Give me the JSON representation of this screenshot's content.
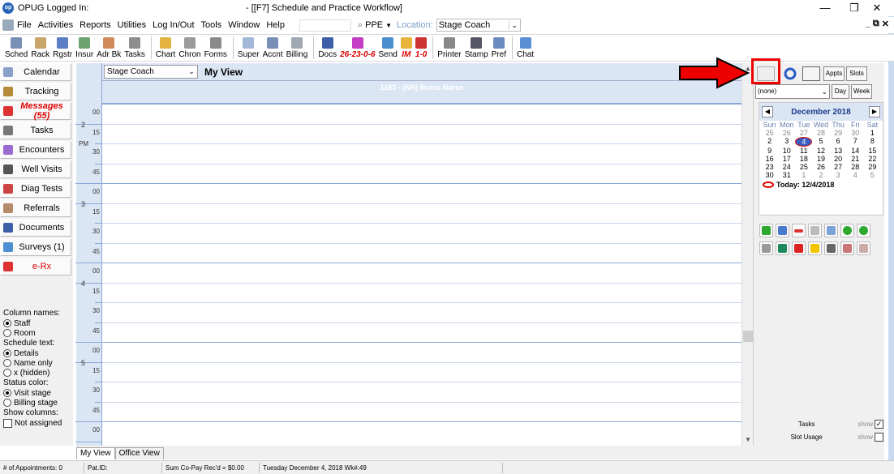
{
  "window": {
    "app_label": "OPUG Logged In:",
    "title": "- [[F7] Schedule and Practice Workflow]",
    "minimize": "—",
    "restore": "❐",
    "close": "✕"
  },
  "menu": {
    "items": [
      "File",
      "Activities",
      "Reports",
      "Utilities",
      "Log In/Out",
      "Tools",
      "Window",
      "Help"
    ],
    "ppe_label": "PPE",
    "location_label": "Location:",
    "location_value": "Stage Coach",
    "mdi_controls": [
      "_",
      "⧉",
      "✕"
    ]
  },
  "toolbar": {
    "groups": [
      [
        {
          "label": "Sched",
          "color": "#7a8fb5"
        },
        {
          "label": "Rack",
          "color": "#c9a56a"
        },
        {
          "label": "Rgstr",
          "color": "#5b7fc7"
        },
        {
          "label": "Insur",
          "color": "#6ca36e"
        },
        {
          "label": "Adr Bk",
          "color": "#d08a5b"
        },
        {
          "label": "Tasks",
          "color": "#8d8d8d"
        }
      ],
      [
        {
          "label": "Chart",
          "color": "#e2b341"
        },
        {
          "label": "Chron",
          "color": "#9a9a9a"
        },
        {
          "label": "Forms",
          "color": "#8a8a8a"
        }
      ],
      [
        {
          "label": "Super",
          "color": "#a3b7d9"
        },
        {
          "label": "Accnt",
          "color": "#7a8fb5"
        },
        {
          "label": "Billing",
          "color": "#9fa7b3"
        }
      ],
      [
        {
          "label": "Docs",
          "color": "#3d5fa8"
        },
        {
          "label": "26-23-0-6",
          "color": "#c53cc5",
          "red": true
        },
        {
          "label": "Send",
          "color": "#4a8fcf"
        },
        {
          "label": "IM",
          "color": "#e8b53b",
          "red": true
        },
        {
          "label": "1-0",
          "color": "#c33",
          "red": true
        }
      ],
      [
        {
          "label": "Printer",
          "color": "#888"
        },
        {
          "label": "Stamp",
          "color": "#556"
        },
        {
          "label": "Pref",
          "color": "#6a8ac0"
        }
      ],
      [
        {
          "label": "Chat",
          "color": "#5a8fd6"
        }
      ]
    ]
  },
  "leftnav": {
    "items": [
      {
        "label": "Calendar",
        "color": "#8aa0c8"
      },
      {
        "label": "Tracking",
        "color": "#b58a3a"
      },
      {
        "label": "Messages (55)",
        "color": "#d33",
        "kind": "msg"
      },
      {
        "label": "Tasks",
        "color": "#777"
      },
      {
        "label": "Encounters",
        "color": "#9a6bd0"
      },
      {
        "label": "Well Visits",
        "color": "#555"
      },
      {
        "label": "Diag Tests",
        "color": "#c44"
      },
      {
        "label": "Referrals",
        "color": "#b58a6a"
      },
      {
        "label": "Documents",
        "color": "#3d5fa8"
      },
      {
        "label": "Surveys (1)",
        "color": "#4a8fcf"
      },
      {
        "label": "e-Rx",
        "color": "#d33",
        "kind": "erx"
      }
    ],
    "options": {
      "column_names_label": "Column names:",
      "column_names": [
        {
          "label": "Staff",
          "on": true
        },
        {
          "label": "Room",
          "on": false
        }
      ],
      "schedule_text_label": "Schedule text:",
      "schedule_text": [
        {
          "label": "Details",
          "on": true
        },
        {
          "label": "Name only",
          "on": false
        },
        {
          "label": "x (hidden)",
          "on": false
        }
      ],
      "status_color_label": "Status color:",
      "status_color": [
        {
          "label": "Visit stage",
          "on": true
        },
        {
          "label": "Billing stage",
          "on": false
        }
      ],
      "show_columns_label": "Show columns:",
      "not_assigned_label": "Not assigned"
    }
  },
  "schedule": {
    "location_select": "Stage Coach",
    "view_title": "My View",
    "column_header": "1163 - (NN) Nurse Nurse",
    "hours": [
      {
        "hour": "2",
        "suffix": "PM",
        "mins": [
          "00",
          "15",
          "30",
          "45"
        ]
      },
      {
        "hour": "3",
        "suffix": "",
        "mins": [
          "00",
          "15",
          "30",
          "45"
        ]
      },
      {
        "hour": "4",
        "suffix": "",
        "mins": [
          "00",
          "15",
          "30",
          "45"
        ]
      },
      {
        "hour": "5",
        "suffix": "",
        "mins": [
          "00",
          "15",
          "30",
          "45"
        ]
      },
      {
        "hour": "",
        "suffix": "",
        "mins": [
          "00"
        ]
      }
    ]
  },
  "rightpanel": {
    "appts_label": "Appts",
    "slots_label": "Slots",
    "none_select": "(none)",
    "day_label": "Day",
    "week_label": "Week",
    "calendar": {
      "month": "December 2018",
      "prev": "◀",
      "next": "▶",
      "day_names": [
        "Sun",
        "Mon",
        "Tue",
        "Wed",
        "Thu",
        "Fri",
        "Sat"
      ],
      "weeks": [
        [
          "25",
          "26",
          "27",
          "28",
          "29",
          "30",
          "1"
        ],
        [
          "2",
          "3",
          "4",
          "5",
          "6",
          "7",
          "8"
        ],
        [
          "9",
          "10",
          "11",
          "12",
          "13",
          "14",
          "15"
        ],
        [
          "16",
          "17",
          "18",
          "19",
          "20",
          "21",
          "22"
        ],
        [
          "23",
          "24",
          "25",
          "26",
          "27",
          "28",
          "29"
        ],
        [
          "30",
          "31",
          "1",
          "2",
          "3",
          "4",
          "5"
        ]
      ],
      "today_label": "Today: 12/4/2018"
    },
    "tasks_label": "Tasks",
    "slot_usage_label": "Slot Usage",
    "show_label": "show",
    "tasks_checked": true,
    "slot_usage_checked": false
  },
  "tabs": {
    "items": [
      {
        "label": "My View",
        "active": true
      },
      {
        "label": "Office View",
        "active": false
      }
    ]
  },
  "status": {
    "cells": [
      "# of Appointments: 0",
      "Pat.ID:",
      "Sum Co-Pay Rec'd = $0.00",
      "Tuesday  December 4, 2018  Wk#:49"
    ]
  },
  "colors": {
    "accent_red": "#e00000",
    "grid_blue": "#dbe6f4",
    "grid_line": "#8aa7d4"
  }
}
